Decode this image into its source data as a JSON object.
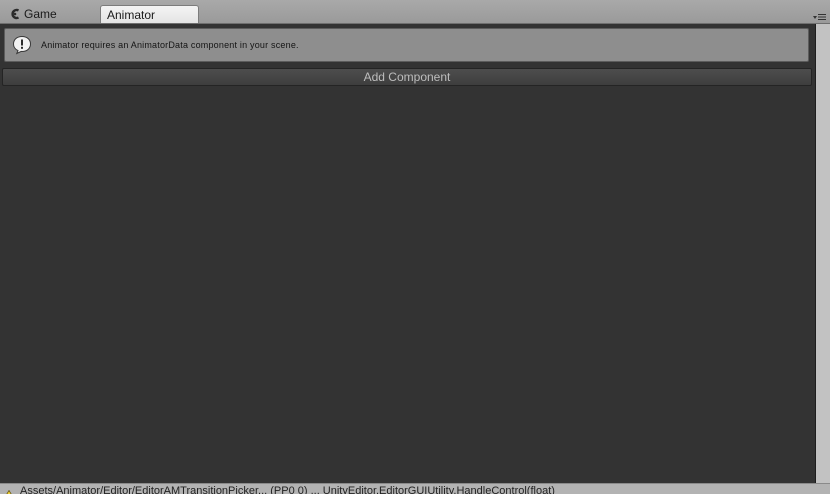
{
  "tabs": {
    "game_label": "Game",
    "animator_label": "Animator"
  },
  "icons": {
    "game": "game-controller-icon",
    "menu": "tab-menu-icon",
    "warning": "exclamation-icon",
    "status_warning": "warning-triangle-icon"
  },
  "help": {
    "message": "Animator requires an AnimatorData component in your scene."
  },
  "add_component": {
    "label": "Add Component"
  },
  "status": {
    "text": "Assets/Animator/Editor/EditorAMTransitionPicker... (PP0 0) ... UnityEditor.EditorGUIUtility.HandleControl(float)"
  },
  "colors": {
    "panel_bg": "#333333",
    "helpbox_bg": "#8e8e8e",
    "button_text": "#bdbdbd",
    "tab_active": "#efefef"
  }
}
